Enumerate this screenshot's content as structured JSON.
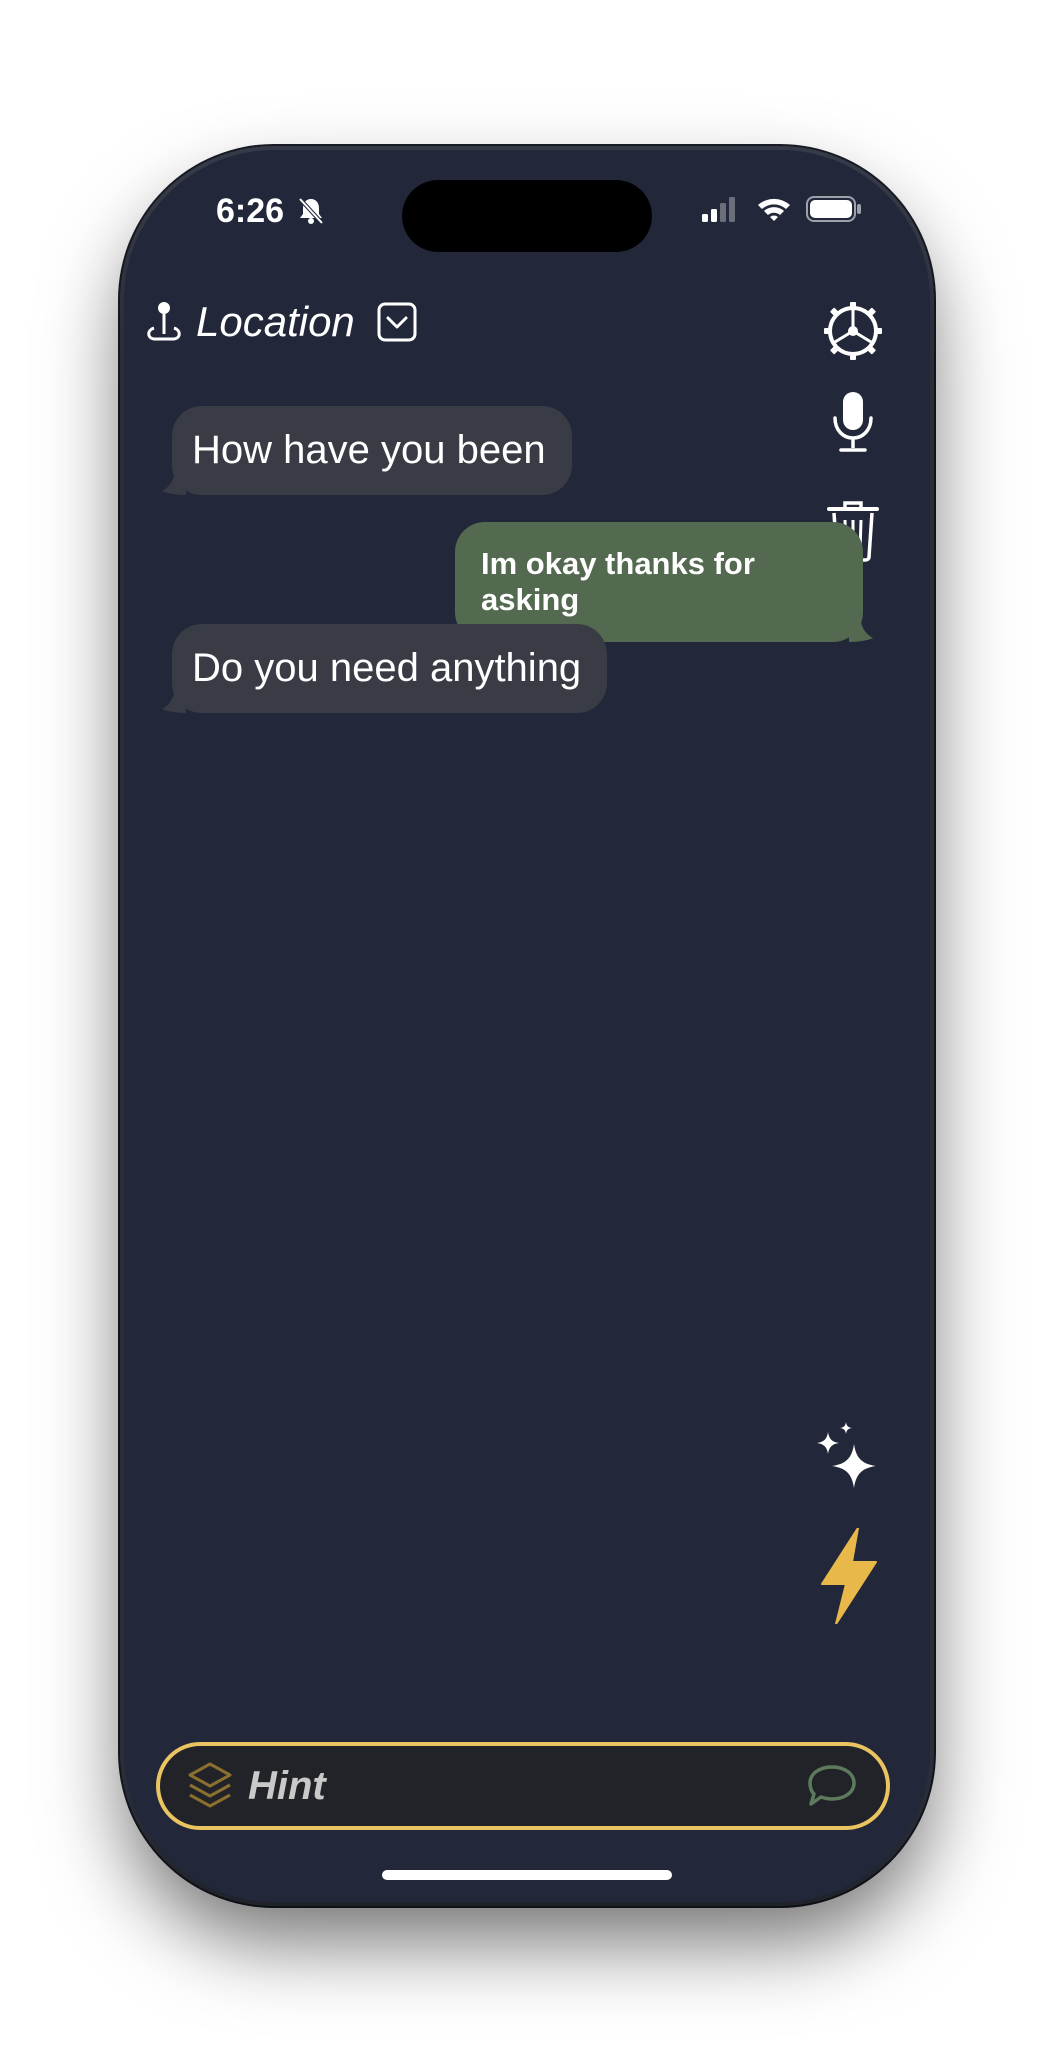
{
  "status_bar": {
    "time": "6:26"
  },
  "header": {
    "location_label": "Location"
  },
  "messages": [
    {
      "text": "How have you been",
      "direction": "incoming"
    },
    {
      "text": "Im okay thanks for asking",
      "direction": "outgoing"
    },
    {
      "text": "Do you need anything",
      "direction": "incoming"
    }
  ],
  "composer": {
    "placeholder": "Hint"
  },
  "colors": {
    "background": "#222839",
    "incoming_bubble": "#3a3c45",
    "outgoing_bubble": "#546a50",
    "hint_border": "#e9c461",
    "bolt": "#e9b84a"
  },
  "icons": {
    "location": "pin-icon",
    "dropdown": "chevron-down-square-icon",
    "settings": "gear-icon",
    "mic": "microphone-icon",
    "trash": "trash-icon",
    "sparkles": "sparkles-icon",
    "bolt": "bolt-icon",
    "layers": "layers-icon",
    "chat": "speech-bubble-icon"
  }
}
